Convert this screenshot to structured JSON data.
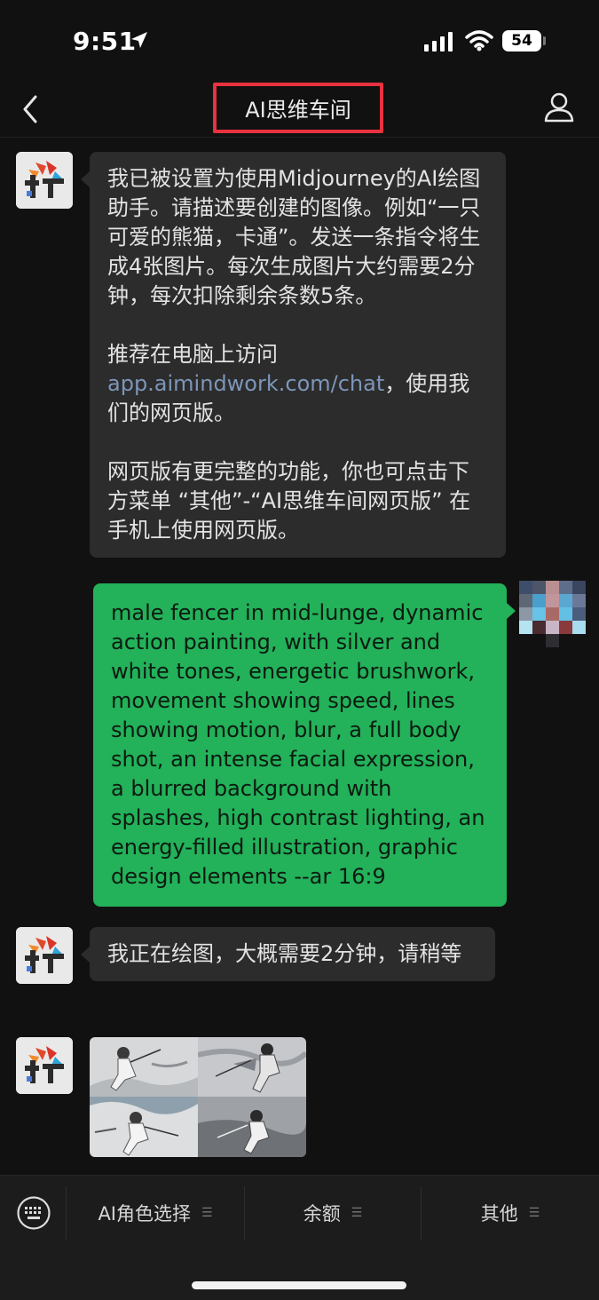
{
  "status_bar": {
    "time": "9:51",
    "battery": "54"
  },
  "nav": {
    "title": "AI思维车间"
  },
  "messages": {
    "m1": {
      "p1": "我已被设置为使用Midjourney的AI绘图助手。请描述要创建的图像。例如“一只可爱的熊猫，卡通”。发送一条指令将生成4张图片。每次生成图片大约需要2分钟，每次扣除剩余条数5条。",
      "p2_prefix": "推荐在电脑上访问",
      "p2_link": "app.aimindwork.com/chat",
      "p2_suffix": "，使用我们的网页版。",
      "p3": "网页版有更完整的功能，你也可点击下方菜单 “其他”-“AI思维车间网页版” 在手机上使用网页版。"
    },
    "m2": {
      "text": "male fencer in mid-lunge, dynamic action painting, with silver and white tones, energetic brushwork, movement showing speed, lines showing motion, blur, a full body shot, an intense facial expression, a blurred background with splashes, high contrast lighting, an energy-filled illustration, graphic design elements --ar 16:9"
    },
    "m3": {
      "text": "我正在绘图，大概需要2分钟，请稍等"
    }
  },
  "menu": {
    "item1": "AI角色选择",
    "item2": "余额",
    "item3": "其他"
  },
  "colors": {
    "accent_green": "#23b15a",
    "highlight_red": "#e8323f",
    "link": "#7d95b8"
  }
}
